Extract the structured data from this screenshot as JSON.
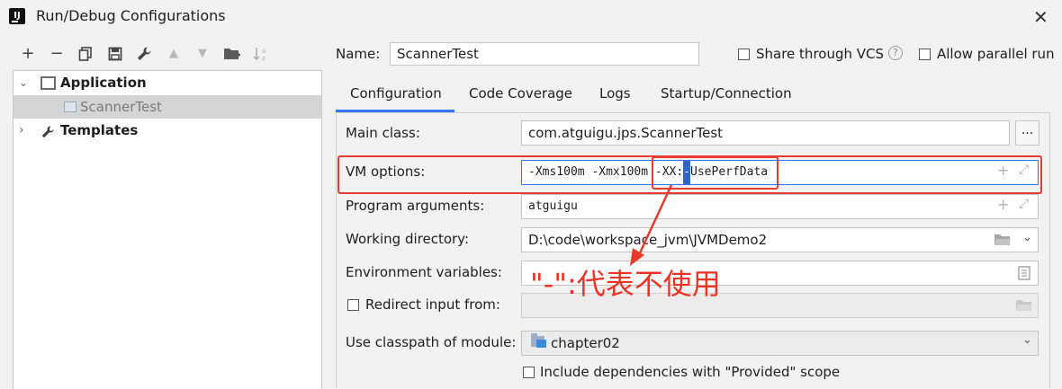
{
  "window": {
    "title": "Run/Debug Configurations",
    "close_icon": "✕"
  },
  "toolbar": {
    "icons": [
      "add-icon",
      "remove-icon",
      "copy-icon",
      "save-icon",
      "wrench-icon",
      "move-up-icon",
      "move-down-icon",
      "new-folder-icon",
      "sort-icon"
    ]
  },
  "tree": {
    "application": "Application",
    "scanner_test": "ScannerTest",
    "templates": "Templates"
  },
  "header": {
    "name_label": "Name:",
    "name_value": "ScannerTest",
    "share_label": "Share through VCS",
    "parallel_label": "Allow parallel run"
  },
  "tabs": [
    "Configuration",
    "Code Coverage",
    "Logs",
    "Startup/Connection"
  ],
  "form": {
    "main_class_label": "Main class:",
    "main_class_value": "com.atguigu.jps.ScannerTest",
    "browse_label": "...",
    "vm_options_label": "VM options:",
    "vm_options_prefix": "-Xms100m -Xmx100m -XX:",
    "vm_options_selected": "-",
    "vm_options_suffix": "UsePerfData",
    "program_args_label": "Program arguments:",
    "program_args_value": "atguigu",
    "working_dir_label": "Working directory:",
    "working_dir_value": "D:\\code\\workspace_jvm\\JVMDemo2",
    "env_vars_label": "Environment variables:",
    "redirect_label": "Redirect input from:",
    "classpath_label": "Use classpath of module:",
    "classpath_value": "chapter02",
    "include_deps_label": "Include dependencies with \"Provided\" scope"
  },
  "annotation": {
    "text": "\"-\":代表不使用"
  },
  "colors": {
    "accent": "#3574f0",
    "annotation": "#e53b31",
    "selection": "#2f65ca"
  }
}
